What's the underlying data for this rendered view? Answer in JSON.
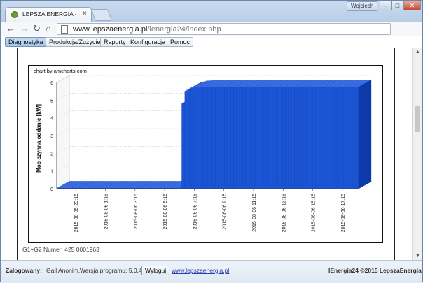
{
  "browser": {
    "tab_title": "LEPSZA ENERGIA - IENERGIA",
    "tab_close": "×",
    "user_badge": "Wojciech",
    "url_host": "www.lepszaenergia.pl",
    "url_path": "/ienergia24/index.php",
    "win_min": "–",
    "win_max": "□",
    "win_close": "✕",
    "back_glyph": "←",
    "forward_glyph": "→",
    "reload_glyph": "↻",
    "home_glyph": "⌂",
    "star_glyph": "☆"
  },
  "app_nav": {
    "items": [
      "Diagnostyka",
      "Produkcja/Zużycie",
      "Raporty",
      "Konfiguracja",
      "Pomoc"
    ],
    "active_index": 0
  },
  "chart": {
    "credit": "chart by amcharts.com",
    "meter_label": "G1+G2 Numer: 425 0001963"
  },
  "chart_data": {
    "type": "bar",
    "title": "",
    "xlabel": "",
    "ylabel": "Moc czynna oddanie [kW]",
    "ylim": [
      0,
      6
    ],
    "y_ticks": [
      "0",
      "1",
      "2",
      "3",
      "4",
      "5",
      "6"
    ],
    "x_tick_labels": [
      "2015-08-05 23:15",
      "2015-08-06 1:15",
      "2015-08-06 3:15",
      "2015-08-06 5:15",
      "2015-08-06 7:15",
      "2015-08-06 9:15",
      "2015-08-06 11:15",
      "2015-08-06 13:15",
      "2015-08-06 15:15",
      "2015-08-06 17:15"
    ],
    "grid": true,
    "three_d": true,
    "bar_color": "#1b55d6",
    "series": [
      {
        "values": [
          0,
          0,
          0,
          0,
          0,
          0,
          0,
          0,
          0,
          0,
          0,
          0,
          0,
          0,
          0,
          0,
          0,
          0,
          0,
          0,
          0,
          0,
          0,
          0,
          0,
          0,
          0,
          0,
          0,
          0,
          0,
          0,
          0,
          0,
          0,
          0,
          0,
          0,
          0,
          0,
          0,
          4.8,
          5.5,
          5.6,
          5.65,
          5.7,
          5.7,
          5.75,
          5.75,
          5.75,
          5.75,
          5.75,
          5.75,
          5.75,
          5.75,
          5.75,
          5.75,
          5.75,
          5.75,
          5.75,
          5.75,
          5.75,
          5.75,
          5.75,
          5.75,
          5.75,
          5.75,
          5.75,
          5.75,
          5.75,
          5.75,
          5.75,
          5.75,
          5.75,
          5.75,
          5.75,
          5.75,
          5.75,
          5.75,
          5.75,
          5.75,
          5.75,
          5.75,
          5.75,
          5.75,
          5.75,
          5.75,
          5.75,
          5.75,
          5.75,
          5.75,
          5.75,
          5.75,
          5.75,
          5.75,
          5.75,
          5.75,
          5.75,
          5.75
        ]
      }
    ]
  },
  "status": {
    "user_label": "Zalogowany:",
    "user_name": "Gall Anonim.",
    "version_text": "Wersja programu: 5.0.4",
    "logout_label": "Wyloguj",
    "site_link": "www.lepszaenergia.pl",
    "copyright": "IEnergia24 ©2015 LepszaEnergia"
  }
}
